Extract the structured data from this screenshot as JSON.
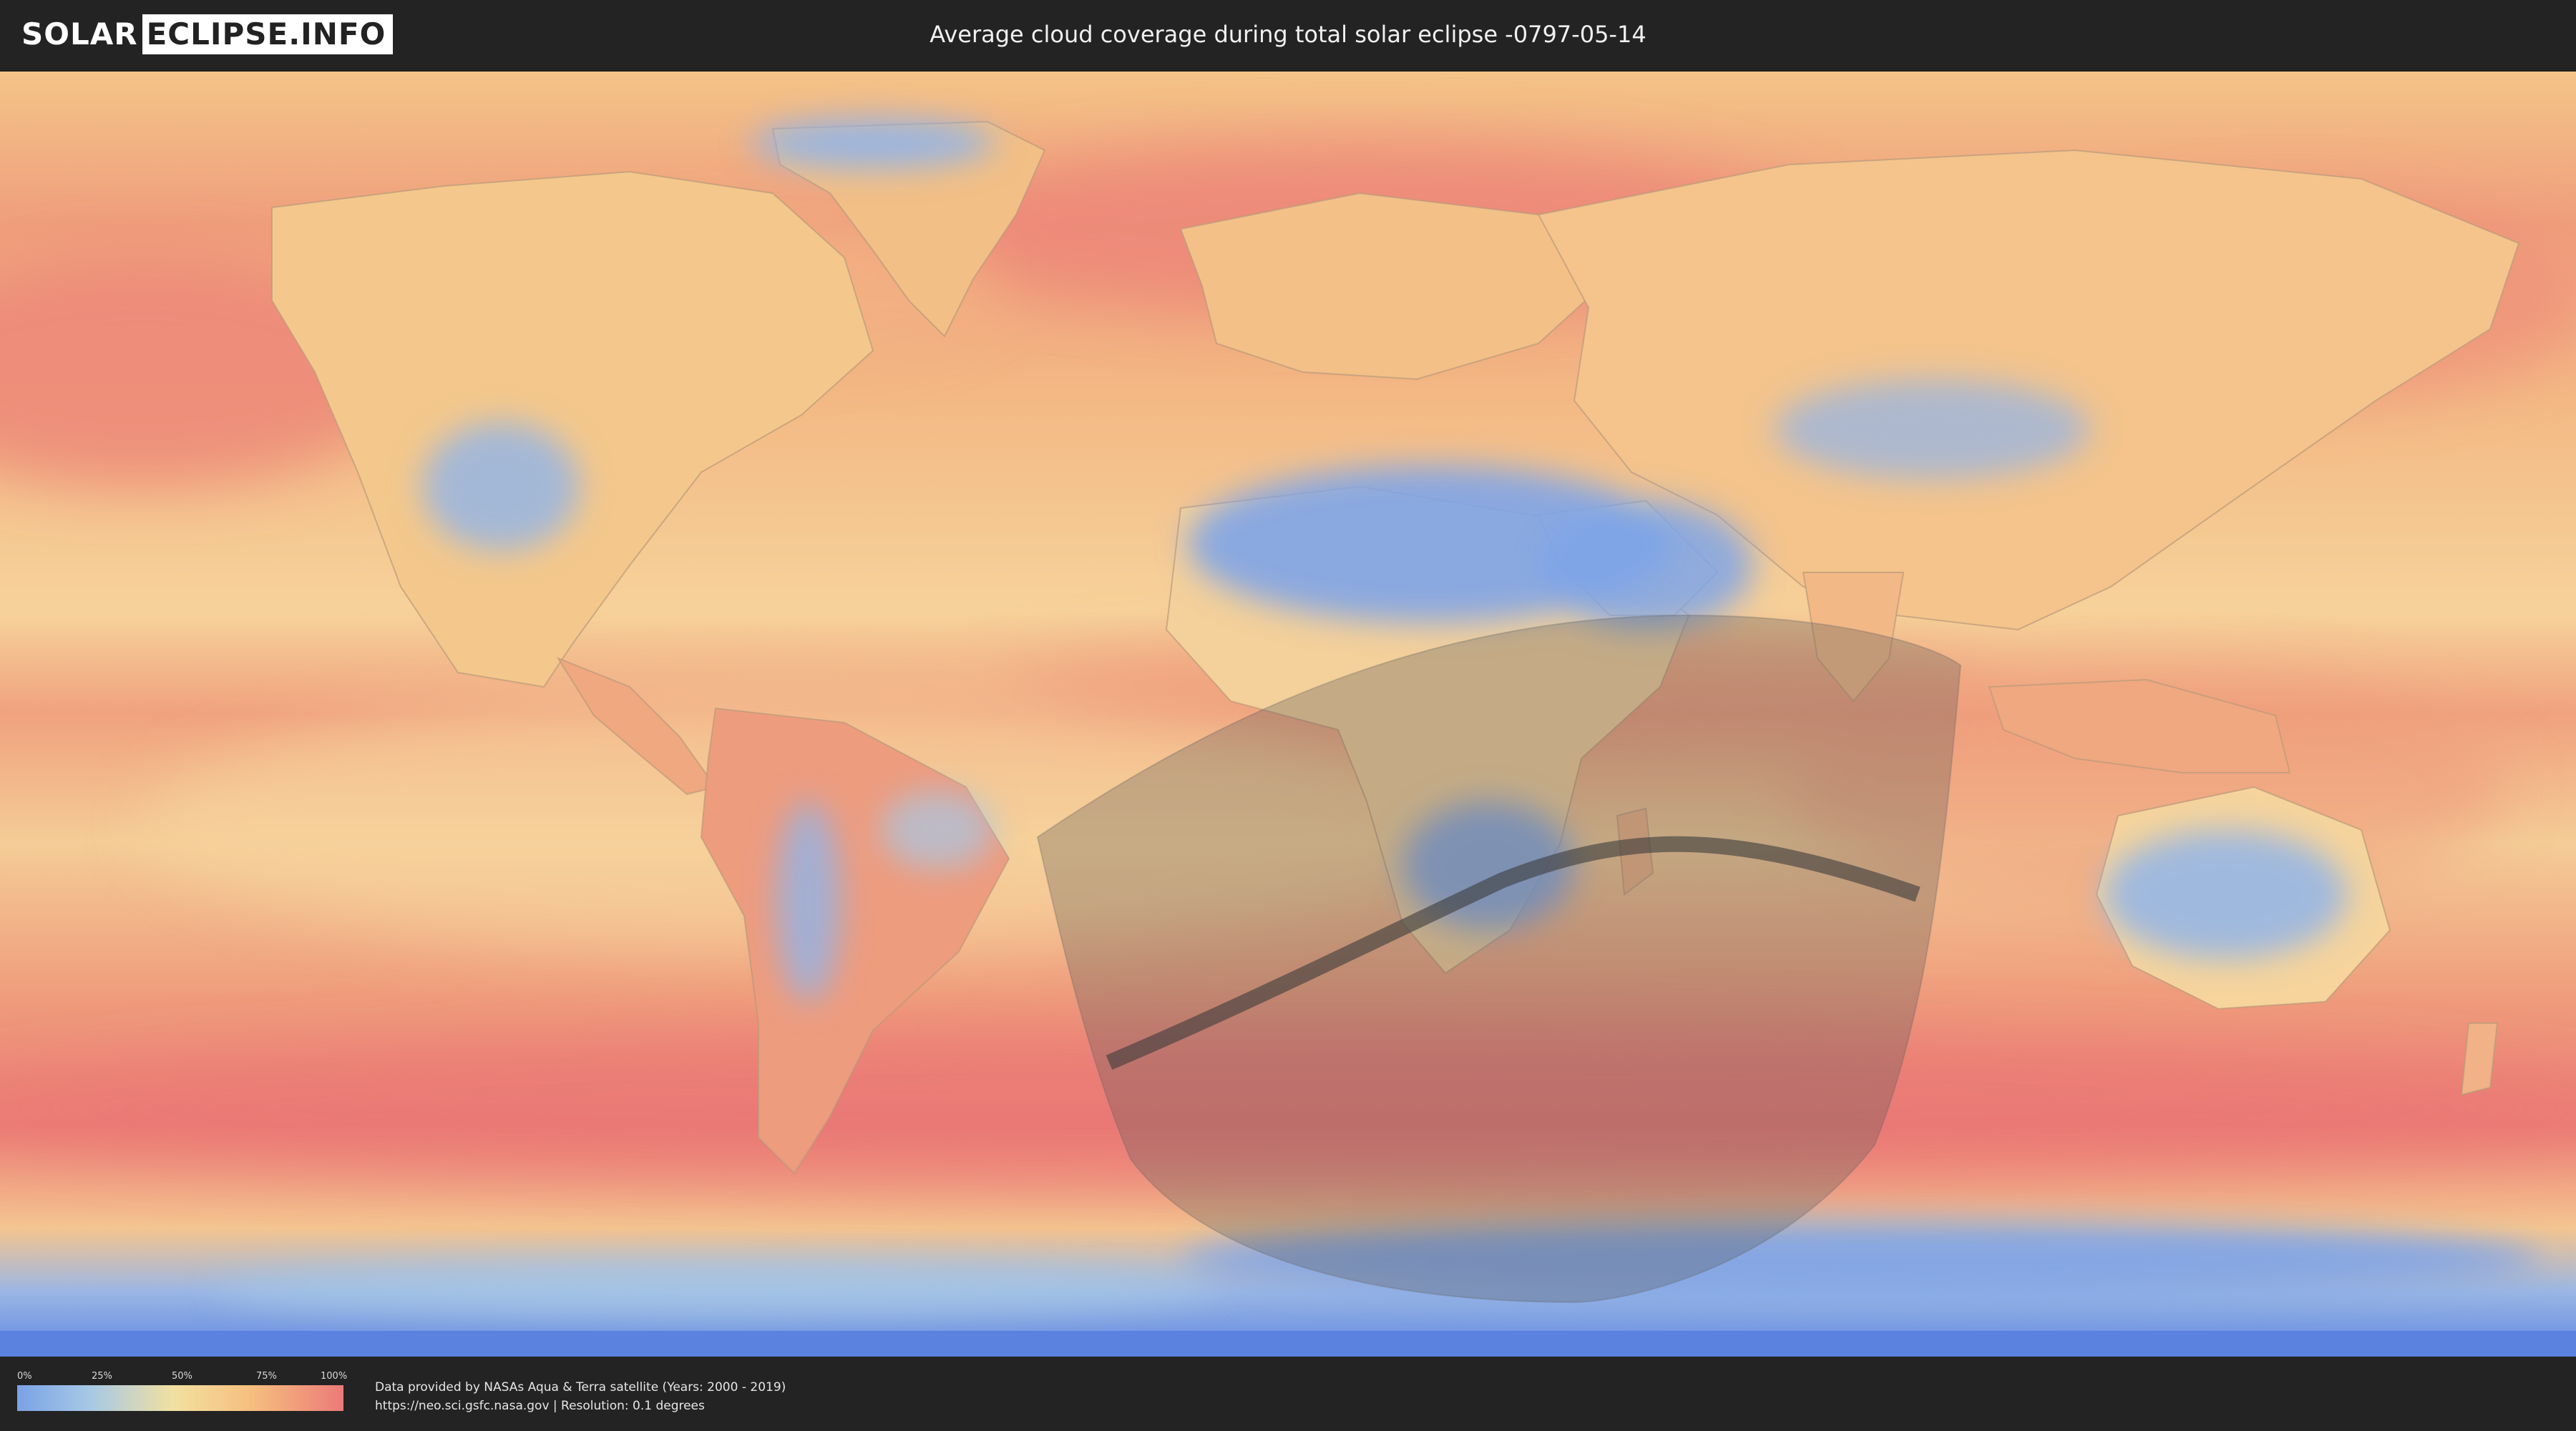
{
  "header": {
    "logo_part1": "SOLAR",
    "logo_part2": "ECLIPSE.INFO",
    "title": "Average cloud coverage during total solar eclipse -0797-05-14"
  },
  "legend": {
    "ticks": [
      "0%",
      "25%",
      "50%",
      "75%",
      "100%"
    ],
    "gradient_colors": [
      "#7aa2e6",
      "#a6c8e6",
      "#f2e0a0",
      "#f6be7e",
      "#ec7a78"
    ]
  },
  "footer": {
    "credit_line": "Data provided by NASAs Aqua & Terra satellite (Years: 2000 - 2019)",
    "source_line": "https://neo.sci.gsfc.nasa.gov | Resolution: 0.1 degrees"
  },
  "colors": {
    "clear": "#7aa2e6",
    "partly": "#f2d69a",
    "cloudy": "#ec7a78",
    "eclipse_shadow": "#555555",
    "totality_path": "#3a3a3a"
  }
}
